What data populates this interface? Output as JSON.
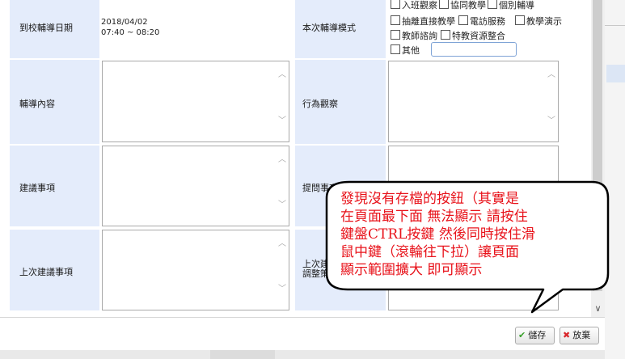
{
  "form": {
    "visit_date_label": "到校輔導日期",
    "visit_date": "2018/04/02",
    "visit_time": "07:40 ~ 08:20",
    "mode_label": "本次輔導模式",
    "mode_options": [
      "入班觀察",
      "協同教學",
      "個別輔導",
      "抽離直接教學",
      "電訪服務",
      "教學演示",
      "教師諮詢",
      "特教資源整合",
      "其他"
    ],
    "content_label": "輔導內容",
    "behavior_label": "行為觀察",
    "suggestion_label": "建議事項",
    "question_label": "提問事項",
    "last_suggestion_label": "上次建議事項",
    "last_adjust_label_line1": "上次建",
    "last_adjust_label_line2": "調整策"
  },
  "footer": {
    "save_label": "儲存",
    "cancel_label": "放棄"
  },
  "callout": {
    "lines": [
      "發現沒有存檔的按鈕（其實是",
      "在頁面最下面 無法顯示 請按住",
      "鍵盤CTRL按鍵 然後同時按住滑",
      "鼠中鍵（滾輪往下拉）讓頁面",
      "顯示範圍擴大 即可顯示"
    ]
  },
  "colors": {
    "label_bg": "#e4ecfb",
    "callout_text": "#e8131b",
    "save_icon": "#3aa02c",
    "cancel_icon": "#d9262b"
  }
}
